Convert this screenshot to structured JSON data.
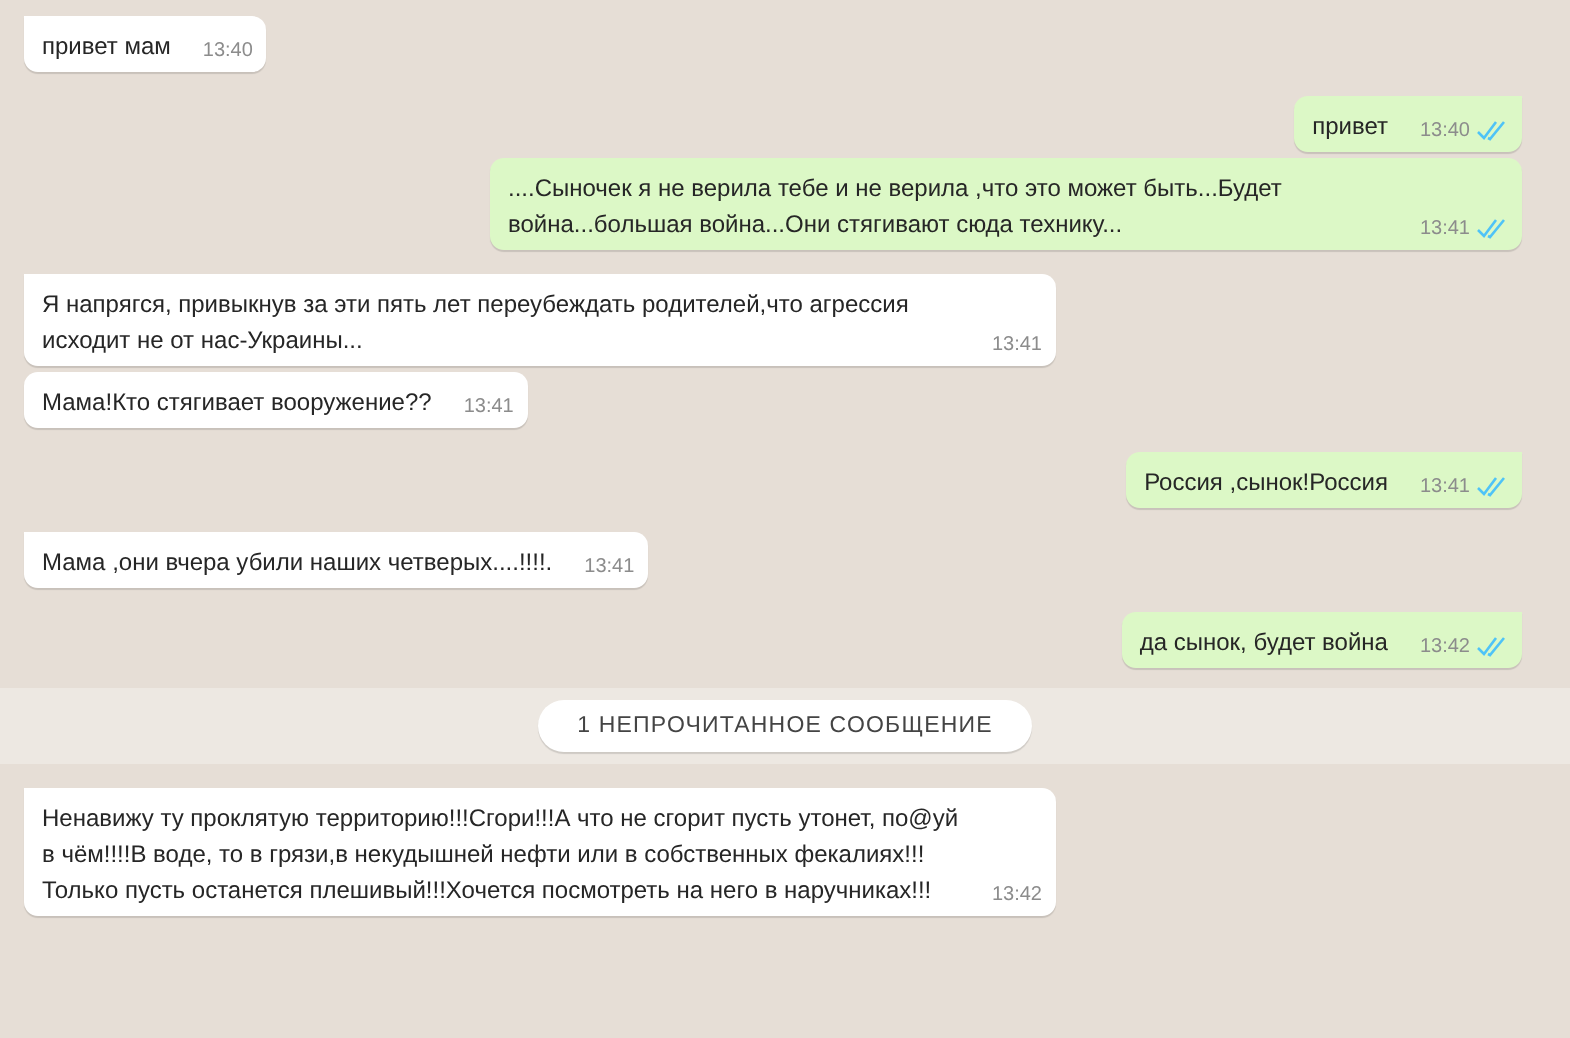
{
  "messages": [
    {
      "kind": "incoming",
      "first": true,
      "text": "привет мам",
      "time": "13:40"
    },
    {
      "kind": "outgoing",
      "first": true,
      "text": "привет",
      "time": "13:40",
      "read": true
    },
    {
      "kind": "outgoing",
      "first": false,
      "text": "....Сыночек я не верила тебе и не верила ,что это может быть...Будет война...большая война...Они стягивают сюда технику...",
      "time": "13:41",
      "read": true
    },
    {
      "kind": "incoming",
      "first": true,
      "text": "Я напрягся, привыкнув за эти пять лет переубеждать родителей,что агрессия исходит не от нас-Украины...",
      "time": "13:41"
    },
    {
      "kind": "incoming",
      "first": false,
      "text": "Мама!Кто стягивает вооружение??",
      "time": "13:41"
    },
    {
      "kind": "outgoing",
      "first": true,
      "text": "Россия ,сынок!Россия",
      "time": "13:41",
      "read": true
    },
    {
      "kind": "incoming",
      "first": true,
      "text": "Мама ,они вчера убили наших четверых....!!!!.",
      "time": "13:41"
    },
    {
      "kind": "outgoing",
      "first": true,
      "text": "да сынок, будет война",
      "time": "13:42",
      "read": true
    },
    {
      "kind": "unread_banner",
      "text": "1 НЕПРОЧИТАННОЕ СООБЩЕНИЕ"
    },
    {
      "kind": "incoming",
      "first": true,
      "text": "Ненавижу ту проклятую территорию!!!Сгори!!!А что не сгорит пусть утонет, по@уй в чём!!!!В воде, то в грязи,в некудышней нефти или в собственных фекалиях!!!Только пусть останется плешивый!!!Хочется посмотреть на него в наручниках!!!",
      "time": "13:42"
    }
  ]
}
